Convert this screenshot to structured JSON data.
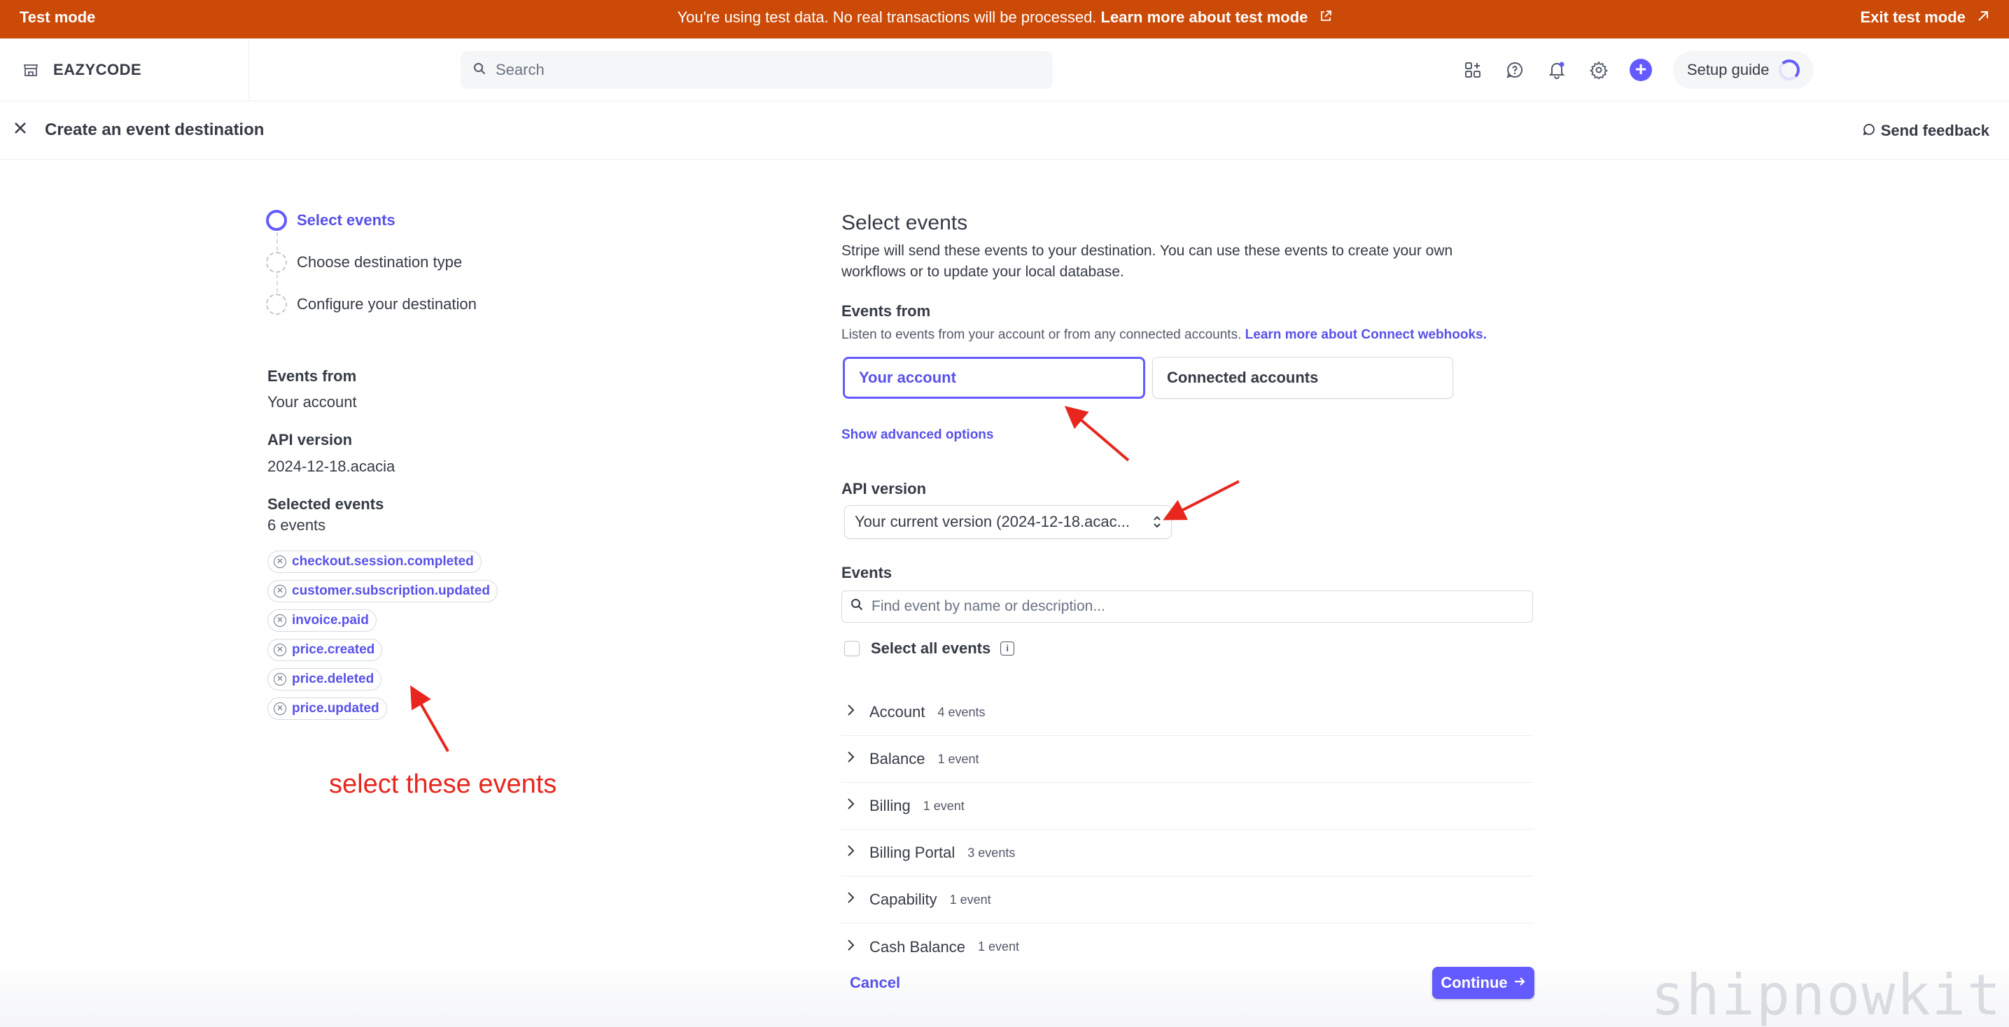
{
  "banner": {
    "mode_label": "Test mode",
    "message": "You're using test data. No real transactions will be processed.",
    "link": "Learn more about test mode",
    "exit_label": "Exit test mode"
  },
  "topnav": {
    "brand": "EAZYCODE",
    "search_placeholder": "Search",
    "setup_guide": "Setup guide"
  },
  "header": {
    "title": "Create an event destination",
    "feedback": "Send feedback"
  },
  "steps": [
    {
      "label": "Select events",
      "state": "active"
    },
    {
      "label": "Choose destination type",
      "state": "pending"
    },
    {
      "label": "Configure your destination",
      "state": "pending"
    }
  ],
  "summary": {
    "events_from_label": "Events from",
    "events_from_value": "Your account",
    "api_version_label": "API version",
    "api_version_value": "2024-12-18.acacia",
    "selected_label": "Selected events",
    "selected_count": "6 events",
    "selected_events": [
      "checkout.session.completed",
      "customer.subscription.updated",
      "invoice.paid",
      "price.created",
      "price.deleted",
      "price.updated"
    ]
  },
  "annotation": {
    "text": "select these events",
    "color": "#e8261e"
  },
  "main": {
    "title": "Select events",
    "description": "Stripe will send these events to your destination. You can use these events to create your own workflows or to update your local database.",
    "events_from_label": "Events from",
    "events_from_help": "Listen to events from your account or from any connected accounts.",
    "events_from_help_link": "Learn more about Connect webhooks.",
    "source_options": [
      "Your account",
      "Connected accounts"
    ],
    "source_selected": "Your account",
    "advanced_link": "Show advanced options",
    "api_version_label": "API version",
    "api_version_select": "Your current version (2024-12-18.acac...",
    "events_label": "Events",
    "events_search_placeholder": "Find event by name or description...",
    "select_all_label": "Select all events",
    "categories": [
      {
        "name": "Account",
        "count": "4 events"
      },
      {
        "name": "Balance",
        "count": "1 event"
      },
      {
        "name": "Billing",
        "count": "1 event"
      },
      {
        "name": "Billing Portal",
        "count": "3 events"
      },
      {
        "name": "Capability",
        "count": "1 event"
      },
      {
        "name": "Cash Balance",
        "count": "1 event"
      }
    ]
  },
  "footer": {
    "cancel": "Cancel",
    "continue": "Continue"
  },
  "watermark": "shipnowkit",
  "colors": {
    "banner": "#cb4a07",
    "accent": "#635bff",
    "link": "#5851e9",
    "text": "#353a44"
  }
}
